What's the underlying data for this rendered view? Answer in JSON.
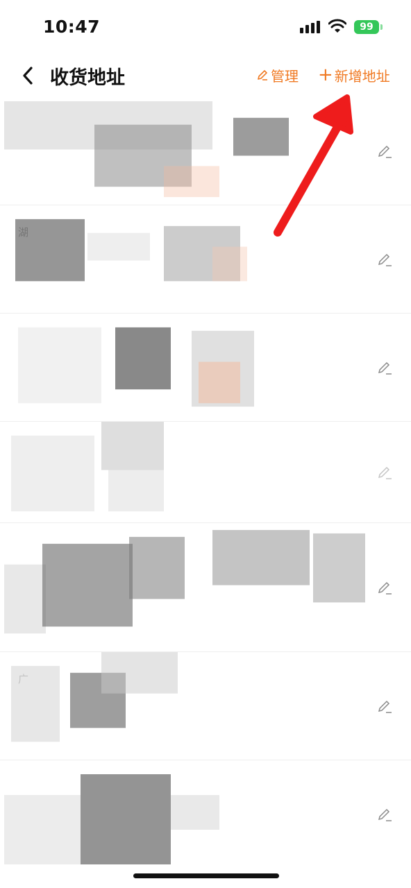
{
  "status_bar": {
    "time": "10:47",
    "battery": "99"
  },
  "header": {
    "title": "收货地址",
    "manage_label": "管理",
    "add_label": "新增地址"
  },
  "addresses": [
    {
      "label": ""
    },
    {
      "label": "湖"
    },
    {
      "label": ""
    },
    {
      "label": ""
    },
    {
      "label": ""
    },
    {
      "label": "广"
    },
    {
      "label": ""
    }
  ],
  "colors": {
    "accent": "#f07a24",
    "annotation": "#ee1c1c",
    "battery": "#34c759"
  }
}
